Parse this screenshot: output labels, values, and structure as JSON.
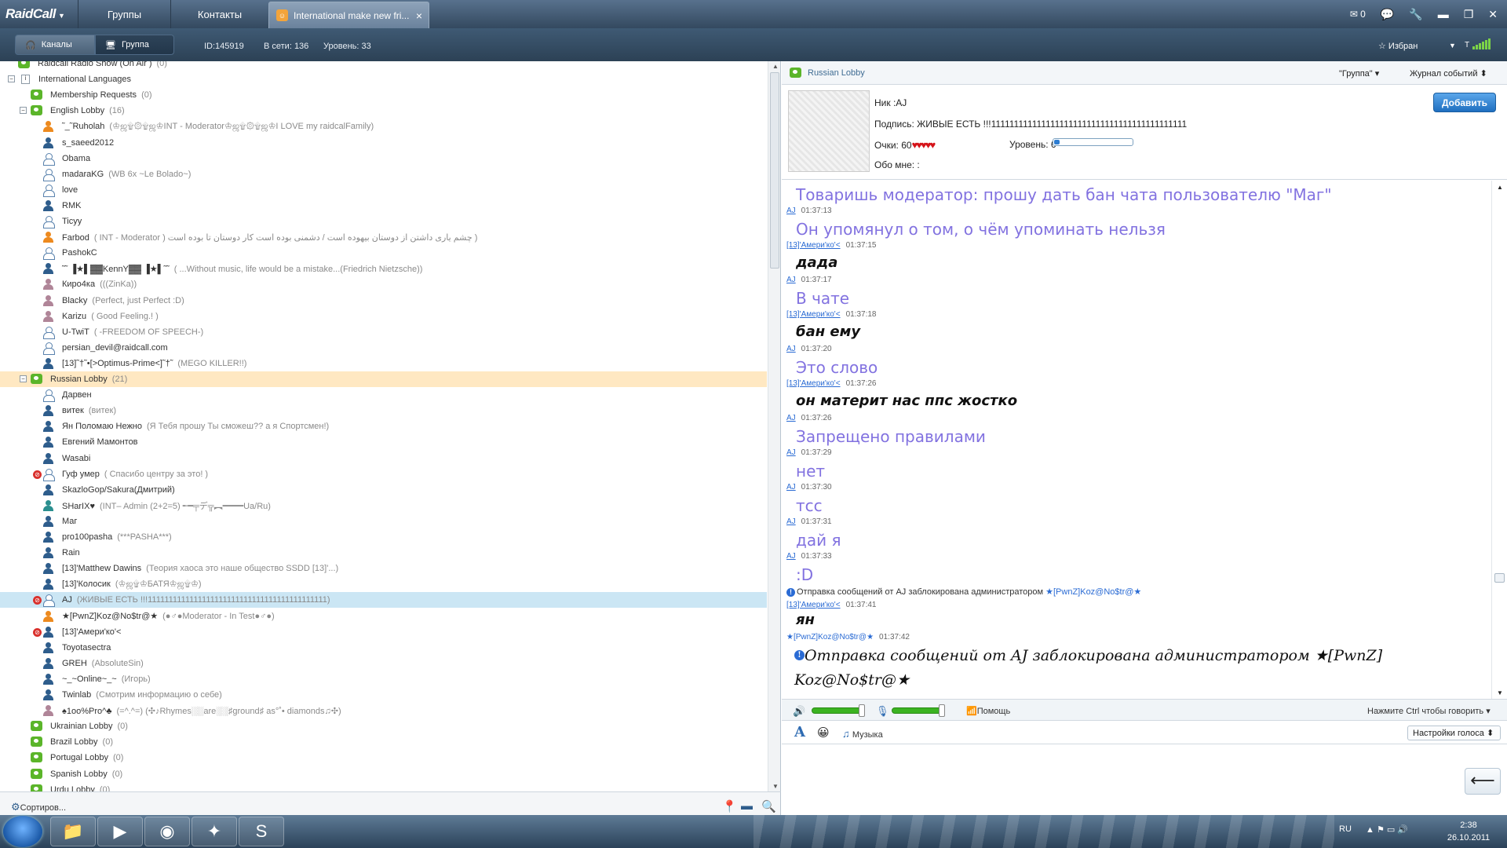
{
  "app": {
    "logo": "RaidCall"
  },
  "topnav": {
    "groups": "Группы",
    "contacts": "Контакты",
    "tab_title": "International make new fri...",
    "mail_count": "0"
  },
  "toolbar": {
    "channels": "Каналы",
    "group": "Группа",
    "id": "ID:145919",
    "online": "В сети: 136",
    "level": "Уровень: 33",
    "favorites": "Избран"
  },
  "tree": [
    {
      "kind": "channel",
      "label": "Raidcall Radio Show (On Air )",
      "count": "(0)"
    },
    {
      "kind": "category",
      "label": "International Languages"
    },
    {
      "kind": "channel",
      "label": "Membership Requests",
      "count": "(0)"
    },
    {
      "kind": "channel",
      "label": "English Lobby",
      "count": "(16)",
      "expanded": true
    },
    {
      "kind": "user",
      "icon": "orange",
      "name": "˜_˜Ruholah",
      "sub": "(♔ஜ۩۞۩ஜ♔INT - Moderator♔ஜ۩۞۩ஜ♔I LOVE my raidcalFamily)"
    },
    {
      "kind": "user",
      "icon": "blue",
      "name": "s_saeed2012"
    },
    {
      "kind": "user",
      "icon": "outline",
      "name": "Obama"
    },
    {
      "kind": "user",
      "icon": "outline",
      "name": "madaraKG",
      "sub": "(WB 6x ~Le Bolado~)"
    },
    {
      "kind": "user",
      "icon": "outline",
      "name": "love"
    },
    {
      "kind": "user",
      "icon": "blue",
      "name": "RMK"
    },
    {
      "kind": "user",
      "icon": "outline",
      "name": "Ticyy"
    },
    {
      "kind": "user",
      "icon": "orange",
      "name": "Farbod",
      "sub": "( INT - Moderator ) چشم یاری داشتن از دوستان بیهوده است / دشمنی بوده است کار دوستان تا بوده است )"
    },
    {
      "kind": "user",
      "icon": "outline",
      "name": "PashokC"
    },
    {
      "kind": "user",
      "icon": "blue",
      "name": "˜˜ ▐★▌▓▓KennY▓▓ ▐★▌˜˜",
      "sub": "( ...Without music,  life would be a mistake...(Friedrich Nietzsche))"
    },
    {
      "kind": "user",
      "icon": "pink",
      "name": "Киро4ка",
      "sub": "(((ZinKa))"
    },
    {
      "kind": "user",
      "icon": "pink",
      "name": "Blacky",
      "sub": "(Perfect, just Perfect :D)"
    },
    {
      "kind": "user",
      "icon": "pink",
      "name": "Karizu",
      "sub": "( Good Feeling.! )"
    },
    {
      "kind": "user",
      "icon": "outline",
      "name": "U-TwiT",
      "sub": "( -FREEDOM OF SPEECH-)"
    },
    {
      "kind": "user",
      "icon": "outline",
      "name": "persian_devil@raidcall.com"
    },
    {
      "kind": "user",
      "icon": "blue",
      "name": "[13]˜†˜•[>Optimus-Prime<]˜†˜",
      "sub": "(MEGO KILLER!!)"
    },
    {
      "kind": "channel",
      "label": "Russian Lobby",
      "count": "(21)",
      "expanded": true,
      "highlight": true
    },
    {
      "kind": "user",
      "icon": "outline",
      "name": "Дарвен"
    },
    {
      "kind": "user",
      "icon": "blue",
      "name": "витек",
      "sub": "(витек)"
    },
    {
      "kind": "user",
      "icon": "blue",
      "name": "Ян Поломаю Нежно",
      "sub": "(Я Тебя прошу Ты сможеш?? а я Спортсмен!)"
    },
    {
      "kind": "user",
      "icon": "blue",
      "name": "Евгений Мамонтов"
    },
    {
      "kind": "user",
      "icon": "blue",
      "name": "Wasabi"
    },
    {
      "kind": "user",
      "icon": "outline",
      "name": "Гуф умер",
      "sub": "(  Спасибо центру за это!   )",
      "blocked": true
    },
    {
      "kind": "user",
      "icon": "blue",
      "name": "SkazloGop/Sakura(Дмитрий)"
    },
    {
      "kind": "user",
      "icon": "teal",
      "name": "SHarIX♥",
      "sub": "(INT– Admin (2+2=5) ╾━╤デ╦︻━━━━Ua/Ru)"
    },
    {
      "kind": "user",
      "icon": "blue",
      "name": "Маг"
    },
    {
      "kind": "user",
      "icon": "blue",
      "name": "pro100pasha",
      "sub": "(***PASHA***)"
    },
    {
      "kind": "user",
      "icon": "blue",
      "name": "Rain"
    },
    {
      "kind": "user",
      "icon": "blue",
      "name": "[13]'Matthew Dawins",
      "sub": "(Теория хаоса это наше общество SSDD [13]'...)"
    },
    {
      "kind": "user",
      "icon": "blue",
      "name": "[13]'Колосик",
      "sub": "(♔ஜ۩♔БАТЯ♔ஜ۩♔)"
    },
    {
      "kind": "user",
      "icon": "outline",
      "name": "AJ",
      "sub": "(ЖИВЫЕ ЕСТЬ !!!1111111111111111111111111111111111111111111)",
      "blocked": true,
      "selected": true
    },
    {
      "kind": "user",
      "icon": "orange",
      "name": "★[PwnZ]Koz@No$tr@★",
      "sub": "(●♂●Moderator - In Test●♂●)"
    },
    {
      "kind": "user",
      "icon": "blue",
      "name": "[13]'Амери'ко'<",
      "blocked": true
    },
    {
      "kind": "user",
      "icon": "blue",
      "name": "Toyotasectra"
    },
    {
      "kind": "user",
      "icon": "blue",
      "name": "GREH",
      "sub": "(AbsoluteSin)"
    },
    {
      "kind": "user",
      "icon": "blue",
      "name": "~_~Online~_~",
      "sub": "(Игорь)"
    },
    {
      "kind": "user",
      "icon": "blue",
      "name": "Twinlab",
      "sub": "(Смотрим информацию о себе)"
    },
    {
      "kind": "user",
      "icon": "pink",
      "name": "♠1oo%Pro^♣",
      "sub": "(=^.^=) (✣♪Rhymes░░are░░♯ground♯ as°˚• diamonds♫✣)"
    },
    {
      "kind": "channel",
      "label": "Ukrainian Lobby",
      "count": "(0)"
    },
    {
      "kind": "channel",
      "label": "Brazil Lobby",
      "count": "(0)"
    },
    {
      "kind": "channel",
      "label": "Portugal Lobby",
      "count": "(0)"
    },
    {
      "kind": "channel",
      "label": "Spanish Lobby",
      "count": "(0)"
    },
    {
      "kind": "channel",
      "label": "Urdu Lobby",
      "count": "(0)"
    }
  ],
  "leftfoot": {
    "sort": "Сортиров..."
  },
  "right": {
    "channel_title": "Russian Lobby",
    "group_dropdown": "\"Группа\"",
    "event_log": "Журнал событий",
    "add_button": "Добавить",
    "profile": {
      "nick": "Ник :AJ",
      "signature": "Подпись: ЖИВЫЕ ЕСТЬ !!!1111111111111111111111111111111111111111111",
      "points_label": "Очки: 60",
      "hearts": "♥♥♥♥♥",
      "level_label": "Уровень: 6",
      "level_fraction": 0.07,
      "about": "Обо мне: :"
    },
    "messages": [
      {
        "text": "Товаришь модератор: прошу дать бан чата пользователю \"Маг\"",
        "style": "light",
        "author": "AJ",
        "time": "01:37:13"
      },
      {
        "text": "Он упомянул о том, о чём упоминать нельзя",
        "style": "light",
        "author": "[13]'Амери'ко'<",
        "time": "01:37:15"
      },
      {
        "text": "дада",
        "style": "bold",
        "author": "AJ",
        "time": "01:37:17"
      },
      {
        "text": "В чате",
        "style": "light",
        "author": "[13]'Амери'ко'<",
        "time": "01:37:18"
      },
      {
        "text": "бан ему",
        "style": "bold",
        "author": "AJ",
        "time": "01:37:20"
      },
      {
        "text": "Это слово",
        "style": "light",
        "author": "[13]'Амери'ко'<",
        "time": "01:37:26"
      },
      {
        "text": "он материт нас ппс жостко",
        "style": "bold",
        "author": "AJ",
        "time": "01:37:26"
      },
      {
        "text": "Запрещено правилами",
        "style": "light",
        "author": "AJ",
        "time": "01:37:29"
      },
      {
        "text": "нет",
        "style": "light",
        "author": "AJ",
        "time": "01:37:30"
      },
      {
        "text": "тсс",
        "style": "light",
        "author": "AJ",
        "time": "01:37:31"
      },
      {
        "text": "дай я",
        "style": "light",
        "author": "AJ",
        "time": "01:37:33"
      },
      {
        "text": ":D",
        "style": "light"
      }
    ],
    "system_notice": {
      "prefix": "Отправка сообщений от AJ заблокирована администратором ",
      "name": "★[PwnZ]Koz@No$tr@★"
    },
    "after_notice": {
      "author": "[13]'Амери'ко'<",
      "time": "01:37:41",
      "text": "ян"
    },
    "moderator_line": {
      "author": "★[PwnZ]Koz@No$tr@★",
      "time": "01:37:42"
    },
    "big_notice": "Отправка сообщений от AJ заблокирована администратором ★[PwnZ] Koz@No$tr@★",
    "voice": {
      "help": "Помощь",
      "ptt": "Нажмите Ctrl чтобы говорить",
      "speaker_level": 0.85,
      "mic_level": 0.85
    },
    "format": {
      "music": "Музыка",
      "voice_settings": "Настройки голоса"
    }
  },
  "taskbar": {
    "lang": "RU",
    "time": "2:38",
    "date": "26.10.2011"
  }
}
